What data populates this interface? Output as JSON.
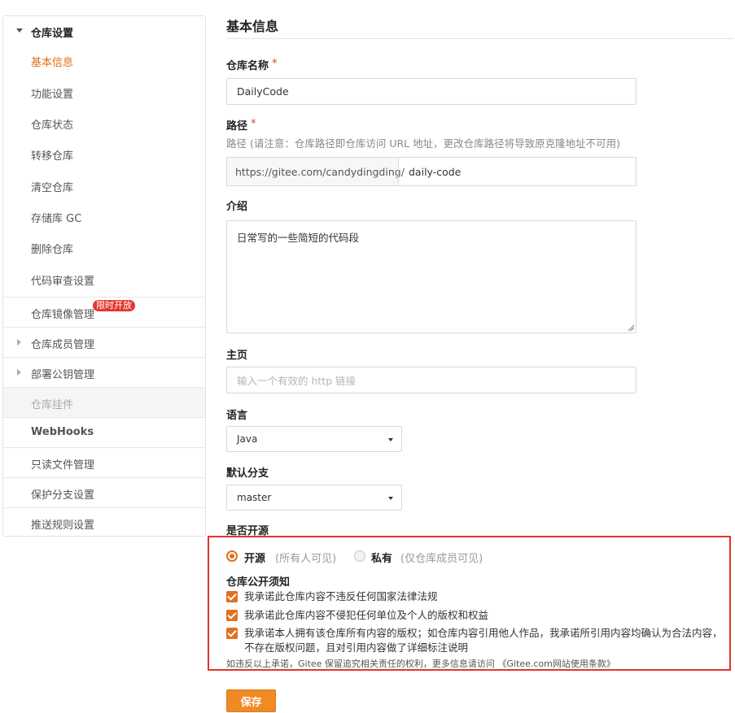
{
  "sidebar": {
    "group_title": "仓库设置",
    "group_items": [
      "基本信息",
      "功能设置",
      "仓库状态",
      "转移仓库",
      "清空仓库",
      "存储库 GC",
      "删除仓库",
      "代码审查设置"
    ],
    "mirror": {
      "label": "仓库镜像管理",
      "badge": "限时开放"
    },
    "members": "仓库成员管理",
    "deploy_keys": "部署公钥管理",
    "widgets": "仓库挂件",
    "webhooks": "WebHooks",
    "readonly_files": "只读文件管理",
    "protected_branches": "保护分支设置",
    "push_rules": "推送规则设置"
  },
  "main": {
    "title": "基本信息",
    "repo_name": {
      "label": "仓库名称",
      "required": "*",
      "value": "DailyCode"
    },
    "path": {
      "label": "路径",
      "required": "*",
      "hint": "路径 (请注意：仓库路径即仓库访问 URL 地址，更改仓库路径将导致原克隆地址不可用)",
      "prefix": "https://gitee.com/candydingding/",
      "value": "daily-code"
    },
    "intro": {
      "label": "介绍",
      "value": "日常写的一些简短的代码段"
    },
    "homepage": {
      "label": "主页",
      "placeholder": "输入一个有效的 http 链接"
    },
    "language": {
      "label": "语言",
      "value": "Java"
    },
    "default_branch": {
      "label": "默认分支",
      "value": "master"
    },
    "open_source": {
      "label": "是否开源",
      "public_label": "开源",
      "public_note": "(所有人可见)",
      "private_label": "私有",
      "private_note": "(仅仓库成员可见)",
      "notice_title": "仓库公开须知",
      "pledges": [
        "我承诺此仓库内容不违反任何国家法律法规",
        "我承诺此仓库内容不侵犯任何单位及个人的版权和权益",
        "我承诺本人拥有该仓库所有内容的版权；如仓库内容引用他人作品，我承诺所引用内容均确认为合法内容，",
        "不存在版权问题，且对引用内容做了详细标注说明"
      ],
      "fine_print": "如违反以上承诺，Gitee 保留追究相关责任的权利，更多信息请访问",
      "fine_print_link": "《Gitee.com网站使用条款》"
    },
    "save_label": "保存"
  },
  "colors": {
    "accent": "#e2711d",
    "active_nav": "#e26e13",
    "highlight_box": "#e4342d",
    "badge": "#e3382f"
  }
}
